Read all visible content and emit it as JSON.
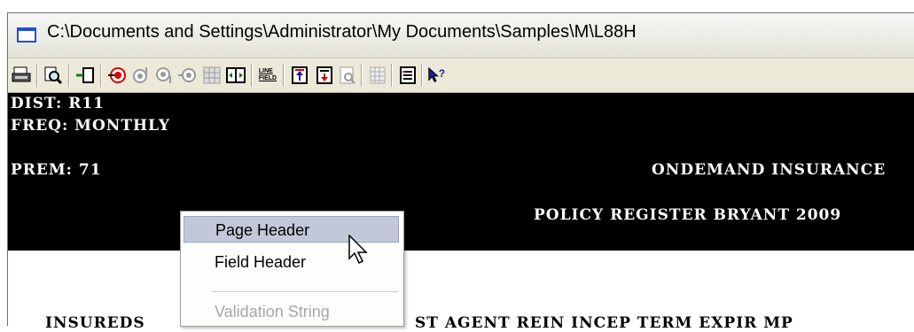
{
  "window": {
    "title": "C:\\Documents and Settings\\Administrator\\My Documents\\Samples\\M\\L88H"
  },
  "toolbar": {
    "buttons": [
      {
        "name": "print-icon",
        "glyph": "🖶"
      },
      {
        "name": "preview-icon",
        "glyph": "🔍"
      },
      {
        "name": "insert-icon",
        "glyph": "⇥"
      },
      {
        "name": "target-red-icon",
        "glyph": "◉"
      },
      {
        "name": "target-up-icon",
        "glyph": "◎"
      },
      {
        "name": "target-down-icon",
        "glyph": "◎"
      },
      {
        "name": "target-left-icon",
        "glyph": "◎"
      },
      {
        "name": "grid-icon",
        "glyph": "▦"
      },
      {
        "name": "split-icon",
        "glyph": "◫"
      },
      {
        "name": "line-field-icon",
        "glyph": "LINE FIELD"
      },
      {
        "name": "page-top-icon",
        "glyph": "⤒"
      },
      {
        "name": "page-header-icon",
        "glyph": "⤓"
      },
      {
        "name": "page-find-icon",
        "glyph": "🗎"
      },
      {
        "name": "columns-icon",
        "glyph": "▥"
      },
      {
        "name": "list-icon",
        "glyph": "☰"
      },
      {
        "name": "help-cursor-icon",
        "glyph": "?"
      }
    ]
  },
  "report": {
    "lines": [
      "DIST: R11",
      "FREQ: MONTHLY",
      "",
      "PREM: 71",
      "ONDEMAND INSURANCE",
      "POLICY REGISTER BRYANT 2009"
    ],
    "header_left": "INSUREDS",
    "header_right": "ST AGENT REIN INCEP TERM EXPIR  MP"
  },
  "context_menu": {
    "items": [
      {
        "label": "Page Header",
        "state": "highlighted"
      },
      {
        "label": "Field Header",
        "state": "normal"
      },
      {
        "label": "Validation String",
        "state": "disabled"
      }
    ]
  }
}
